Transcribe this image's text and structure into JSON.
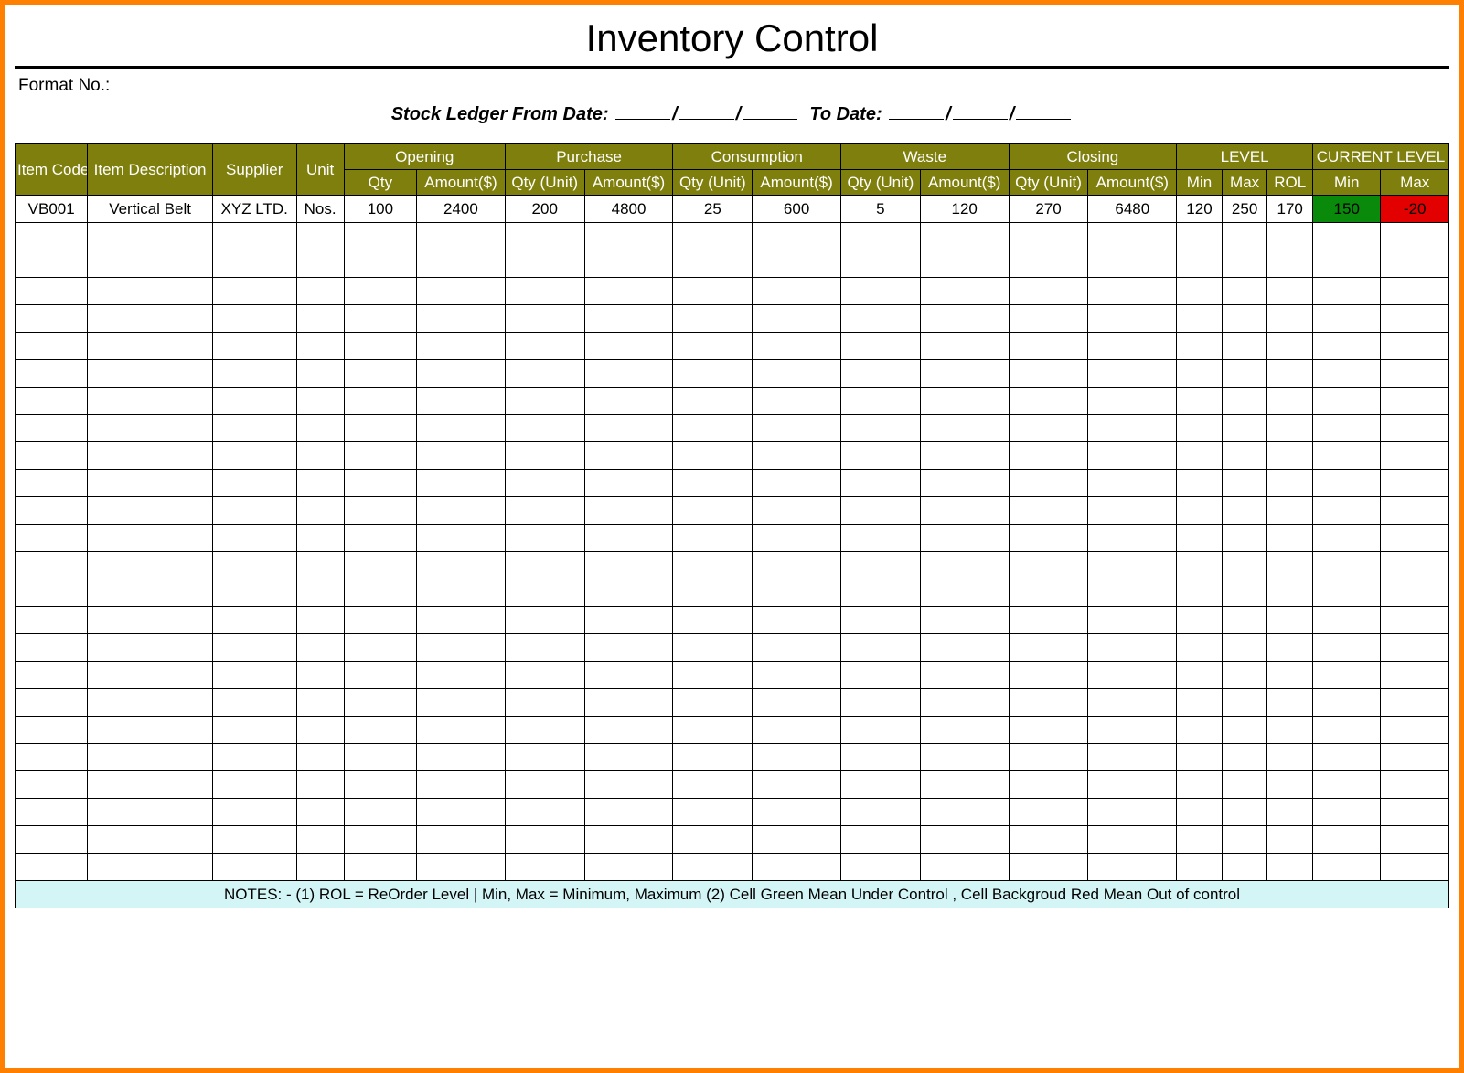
{
  "title": "Inventory Control",
  "format_no_label": "Format No.:",
  "date_line": {
    "prefix": "Stock Ledger From Date:",
    "to_label": "To Date:"
  },
  "headers": {
    "item_code": "Item Code",
    "item_desc": "Item Description",
    "supplier": "Supplier",
    "unit": "Unit",
    "opening": "Opening",
    "purchase": "Purchase",
    "consumption": "Consumption",
    "waste": "Waste",
    "closing": "Closing",
    "level": "LEVEL",
    "current_level": "CURRENT LEVEL",
    "qty": "Qty",
    "amount": "Amount($)",
    "qty_unit": "Qty (Unit)",
    "min": "Min",
    "max": "Max",
    "rol": "ROL"
  },
  "rows": [
    {
      "item_code": "VB001",
      "item_desc": "Vertical Belt",
      "supplier": "XYZ LTD.",
      "unit": "Nos.",
      "open_qty": "100",
      "open_amt": "2400",
      "pur_qty": "200",
      "pur_amt": "4800",
      "con_qty": "25",
      "con_amt": "600",
      "waste_qty": "5",
      "waste_amt": "120",
      "close_qty": "270",
      "close_amt": "6480",
      "lvl_min": "120",
      "lvl_max": "250",
      "lvl_rol": "170",
      "cur_min": "150",
      "cur_max": "-20",
      "cur_min_class": "cell-green",
      "cur_max_class": "cell-red"
    }
  ],
  "empty_row_count": 24,
  "notes": "NOTES: - (1) ROL = ReOrder Level | Min, Max = Minimum, Maximum     (2) Cell Green Mean Under Control , Cell Backgroud Red Mean Out of control",
  "colors": {
    "header_bg": "#7f7f0d",
    "green": "#0a8a0a",
    "red": "#e20000",
    "notes_bg": "#d4f5f5",
    "border": "#ff7f00"
  }
}
